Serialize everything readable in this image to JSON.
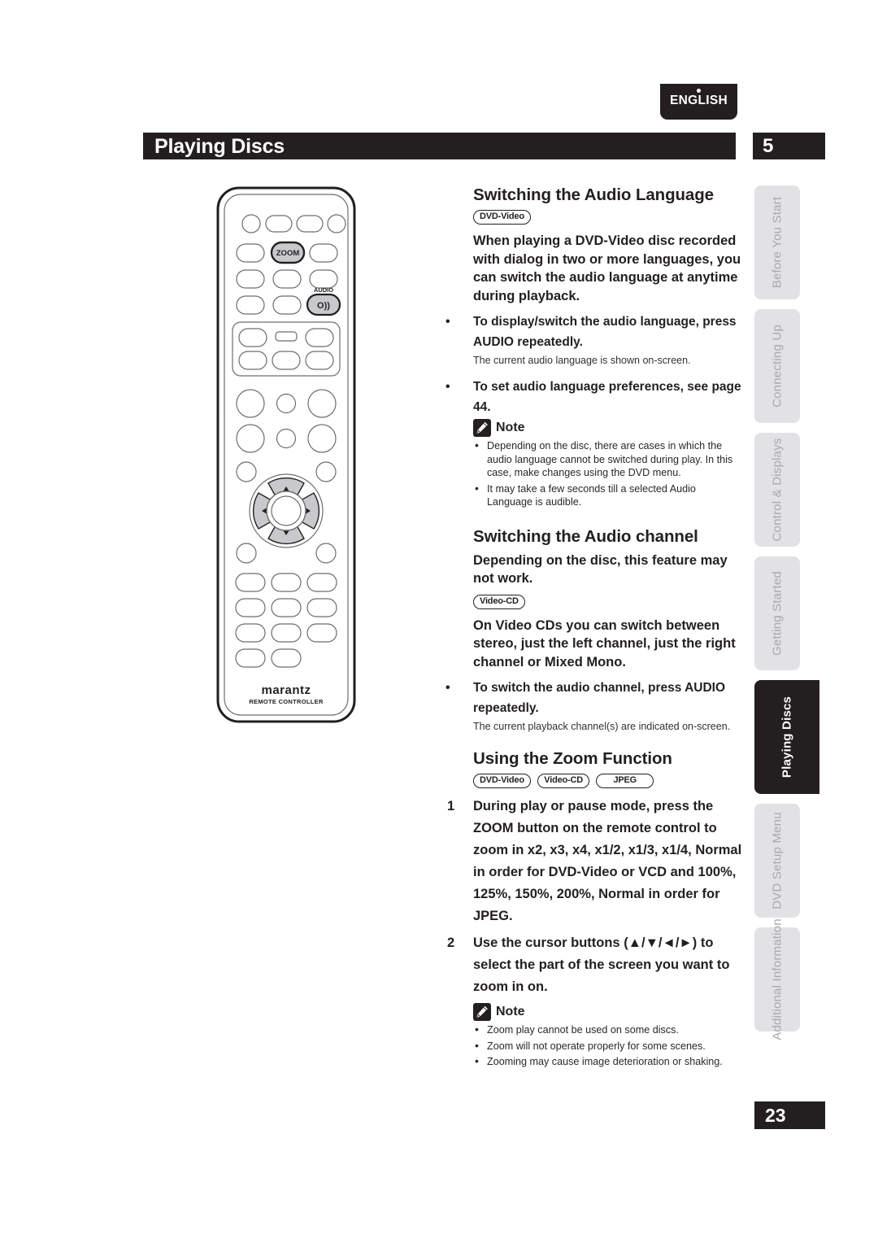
{
  "language_tab": {
    "label": "ENGLISH"
  },
  "header": {
    "title": "Playing Discs",
    "chapter": "5"
  },
  "page_number": "23",
  "remote": {
    "brand": "marantz",
    "subtitle": "REMOTE CONTROLLER",
    "zoom_button_label": "ZOOM",
    "audio_button_label": "AUDIO",
    "audio_button_glyph": "O))"
  },
  "sections": [
    {
      "id": "audio-language",
      "heading": "Switching the Audio Language",
      "badges": [
        "DVD-Video"
      ],
      "intro": "When playing a DVD-Video disc recorded with dialog in two or more languages, you can switch the audio language at anytime during playback.",
      "bullets": [
        {
          "head": "To display/switch the audio language, press AUDIO repeatedly.",
          "sub": "The current audio language is shown on-screen."
        },
        {
          "head": "To set audio language preferences, see page 44.",
          "sub": ""
        }
      ],
      "note": {
        "title": "Note",
        "items": [
          "Depending on the disc, there are cases in which the audio language cannot be switched during play. In this case, make changes using the DVD menu.",
          "It may take a few seconds till a selected Audio Language is audible."
        ]
      }
    },
    {
      "id": "audio-channel",
      "heading": "Switching the Audio channel",
      "intro": "Depending on the disc, this feature may not work.",
      "badges": [
        "Video-CD"
      ],
      "body": "On Video CDs you can switch between stereo, just the left channel, just the right channel or Mixed Mono.",
      "bullets": [
        {
          "head": "To switch the audio channel, press AUDIO repeatedly.",
          "sub": "The current playback channel(s) are indicated on-screen."
        }
      ]
    },
    {
      "id": "zoom-function",
      "heading": "Using the Zoom Function",
      "badges": [
        "DVD-Video",
        "Video-CD",
        "JPEG"
      ],
      "steps": [
        {
          "num": "1",
          "text": "During play or pause mode, press the ZOOM button on the remote control to zoom in x2, x3, x4, x1/2, x1/3, x1/4, Normal in order for DVD-Video or VCD and 100%, 125%, 150%, 200%, Normal in order for JPEG."
        },
        {
          "num": "2",
          "text": "Use the cursor buttons (▲/▼/◄/►) to select the part of the screen you want to zoom in on."
        }
      ],
      "note": {
        "title": "Note",
        "items": [
          "Zoom play cannot be used on some discs.",
          "Zoom will not operate properly for some scenes.",
          "Zooming may cause image deterioration or shaking."
        ]
      }
    }
  ],
  "side_tabs": [
    {
      "label": "Before You Start",
      "active": false
    },
    {
      "label": "Connecting Up",
      "active": false
    },
    {
      "label": "Control & Displays",
      "active": false
    },
    {
      "label": "Getting Started",
      "active": false
    },
    {
      "label": "Playing Discs",
      "active": true
    },
    {
      "label": "DVD Setup Menu",
      "active": false
    },
    {
      "label": "Additional Information",
      "active": false
    }
  ],
  "colors": {
    "ink": "#231f20",
    "tab_inactive_bg": "#e2e2e5",
    "tab_inactive_text": "#a8a8ad",
    "button_gray": "#c9c9cc"
  }
}
